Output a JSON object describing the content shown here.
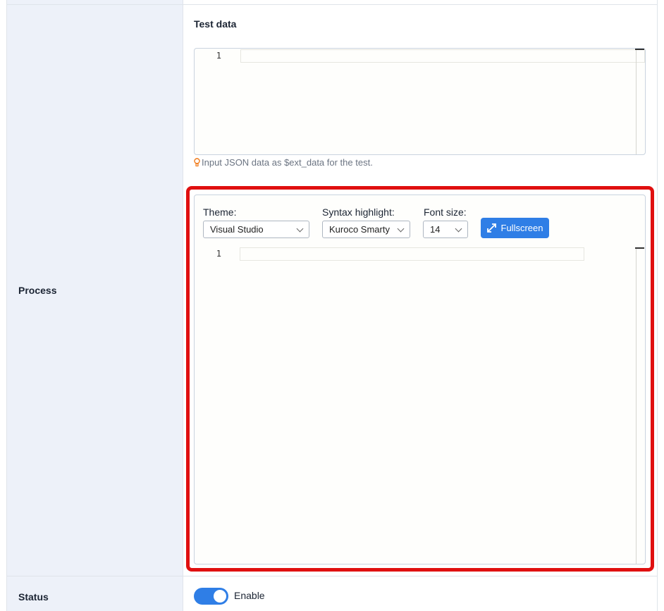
{
  "test_data": {
    "title": "Test data",
    "line_number": "1",
    "hint": "Input JSON data as $ext_data for the test."
  },
  "process": {
    "label": "Process",
    "theme_label": "Theme:",
    "theme_value": "Visual Studio",
    "syntax_label": "Syntax highlight:",
    "syntax_value": "Kuroco Smarty",
    "font_size_label": "Font size:",
    "font_size_value": "14",
    "fullscreen_label": "Fullscreen",
    "line_number": "1"
  },
  "status": {
    "label": "Status",
    "toggle_text": "Enable",
    "enabled": true
  },
  "colors": {
    "accent": "#2f7ee6",
    "highlight": "#e01010",
    "label_column_bg": "#edf1f9"
  },
  "icons": {
    "hint": "lightbulb-icon",
    "fullscreen": "expand-arrows-icon",
    "dropdown": "chevron-down-icon"
  }
}
